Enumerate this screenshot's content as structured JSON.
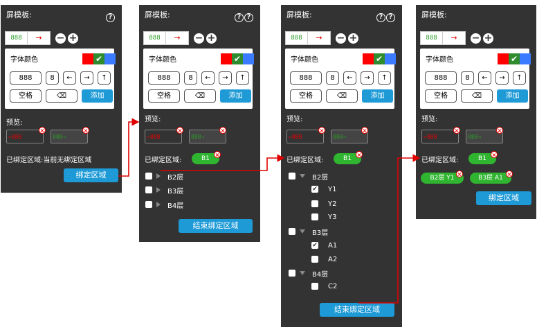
{
  "common": {
    "panel_title": "屏模板:",
    "help_q": "?",
    "seg_value": "888",
    "seg_arrow": "→",
    "minus": "−",
    "plus": "+",
    "font_color_label": "字体颜色",
    "check": "✔",
    "key_888": "888",
    "key_8": "8",
    "key_left": "←",
    "key_right": "→",
    "key_up": "↑",
    "key_space": "空格",
    "key_backspace": "⌫",
    "add_label": "添加",
    "preview_label": "预览:",
    "preview1_text": "←888",
    "preview2_text": "888→",
    "close_x": "×",
    "bound_label": "已绑定区域:"
  },
  "panel1": {
    "bound_status": "当前无绑定区域",
    "bind_button": "绑定区域"
  },
  "panel2": {
    "pill": "B1",
    "layers": [
      "B2层",
      "B3层",
      "B4层"
    ],
    "end_button": "结束绑定区域"
  },
  "panel3": {
    "pill": "B1",
    "layers": [
      {
        "name": "B2层",
        "children": [
          {
            "name": "Y1",
            "checked": true
          },
          {
            "name": "Y2",
            "checked": false
          },
          {
            "name": "Y3",
            "checked": false
          }
        ]
      },
      {
        "name": "B3层",
        "children": [
          {
            "name": "A1",
            "checked": true
          },
          {
            "name": "A2",
            "checked": false
          }
        ]
      },
      {
        "name": "B4层",
        "children": [
          {
            "name": "C2",
            "checked": false
          }
        ]
      }
    ],
    "end_button": "结束绑定区域"
  },
  "panel4": {
    "pill": "B1",
    "pill_b2": "B2层 Y1",
    "pill_b3": "B3层 A1",
    "bind_button": "绑定区域"
  },
  "colors": {
    "panel_bg": "#333333",
    "accent_blue": "#1e9ad6",
    "pill_green": "#2fb52f",
    "connector_red": "#e00000"
  }
}
